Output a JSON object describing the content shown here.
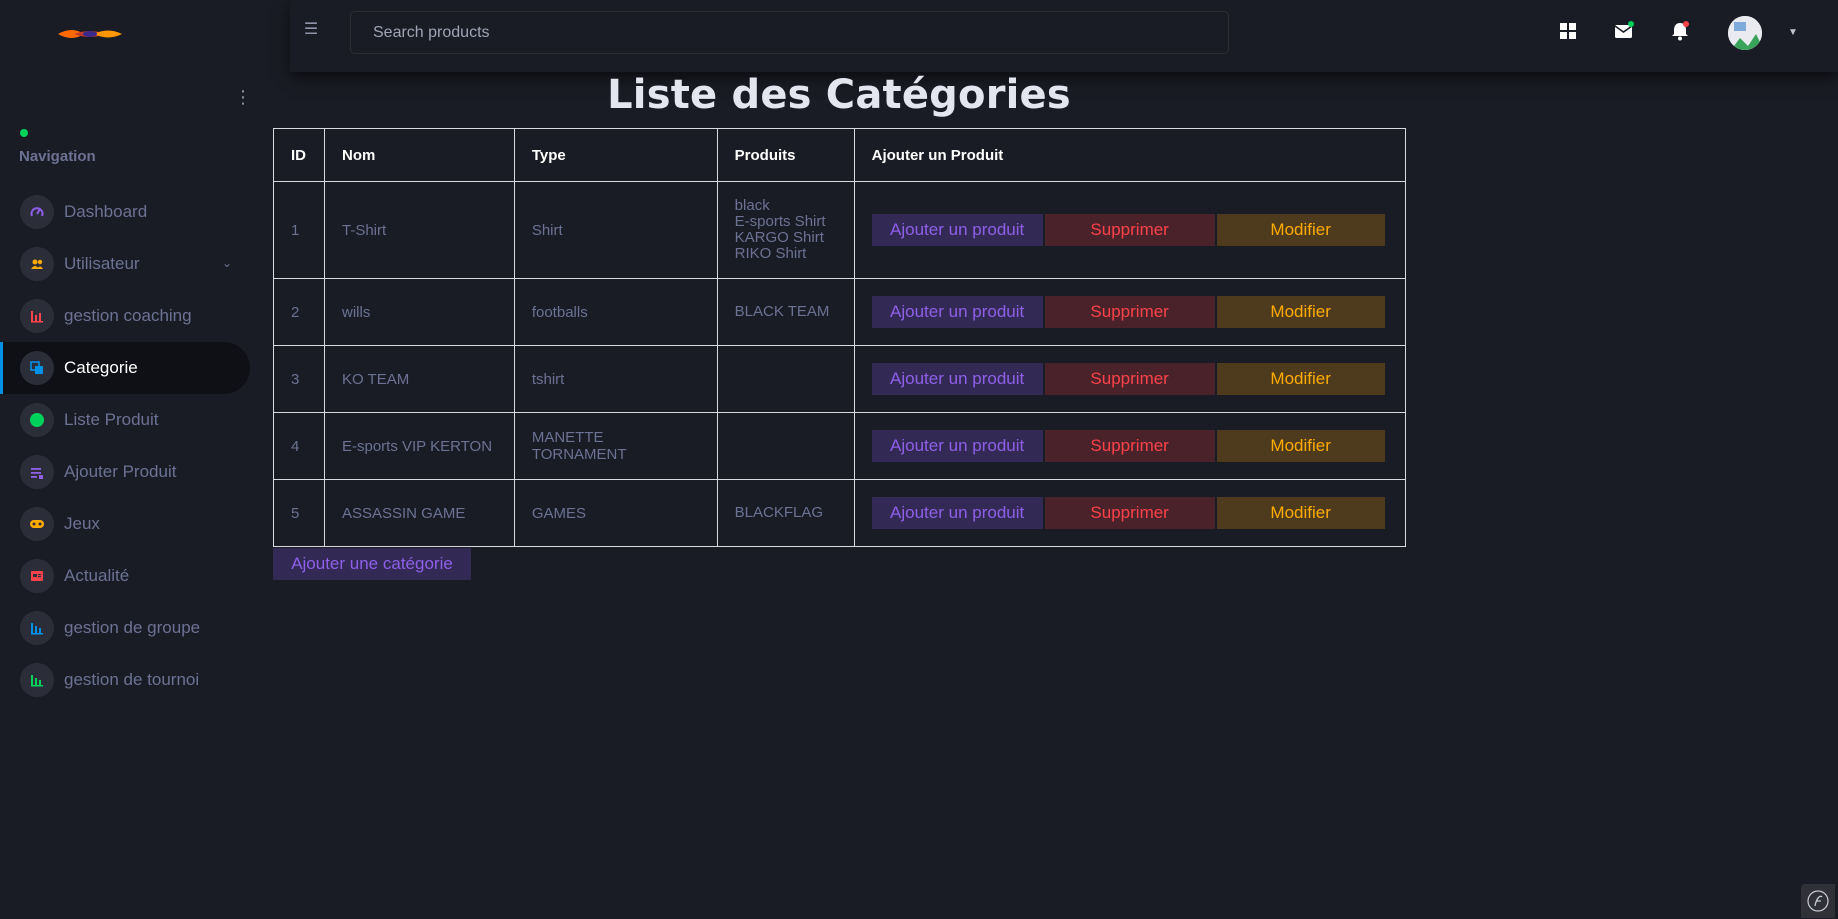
{
  "header": {
    "search_placeholder": "Search products",
    "icons": [
      "grid-icon",
      "mail-icon",
      "bell-icon"
    ],
    "mail_dot_color": "#00d25b",
    "bell_dot_color": "#fc424a"
  },
  "sidebar": {
    "heading": "Navigation",
    "status_color": "#00d25b",
    "items": [
      {
        "label": "Dashboard",
        "icon": "speedometer-icon",
        "color": "#8f5fe8"
      },
      {
        "label": "Utilisateur",
        "icon": "users-icon",
        "color": "#ffab00",
        "expandable": true
      },
      {
        "label": "gestion coaching",
        "icon": "bar-chart-icon",
        "color": "#fc424a"
      },
      {
        "label": "Categorie",
        "icon": "copy-icon",
        "color": "#0090e7",
        "active": true
      },
      {
        "label": "Liste Produit",
        "icon": "circle-icon",
        "color": "#00d25b"
      },
      {
        "label": "Ajouter Produit",
        "icon": "list-icon",
        "color": "#8f5fe8"
      },
      {
        "label": "Jeux",
        "icon": "gamepad-icon",
        "color": "#ffab00"
      },
      {
        "label": "Actualité",
        "icon": "newspaper-icon",
        "color": "#fc424a"
      },
      {
        "label": "gestion de groupe",
        "icon": "chart-icon",
        "color": "#0090e7"
      },
      {
        "label": "gestion de tournoi",
        "icon": "chart-icon",
        "color": "#00d25b"
      }
    ]
  },
  "main": {
    "title": "Liste des Catégories",
    "columns": [
      "ID",
      "Nom",
      "Type",
      "Produits",
      "Ajouter un Produit"
    ],
    "rows": [
      {
        "id": "1",
        "nom": "T-Shirt",
        "type": "Shirt",
        "produits": [
          "black",
          "E-sports Shirt",
          "KARGO Shirt",
          "RIKO Shirt"
        ]
      },
      {
        "id": "2",
        "nom": "wills",
        "type": "footballs",
        "produits": [
          "BLACK TEAM"
        ]
      },
      {
        "id": "3",
        "nom": "KO TEAM",
        "type": "tshirt",
        "produits": []
      },
      {
        "id": "4",
        "nom": "E-sports VIP KERTON",
        "type": "MANETTE TORNAMENT",
        "produits": []
      },
      {
        "id": "5",
        "nom": "ASSASSIN GAME",
        "type": "GAMES",
        "produits": [
          "BLACKFLAG"
        ]
      }
    ],
    "actions": {
      "add_product": "Ajouter un produit",
      "delete": "Supprimer",
      "edit": "Modifier"
    },
    "add_category_label": "Ajouter une catégorie"
  }
}
